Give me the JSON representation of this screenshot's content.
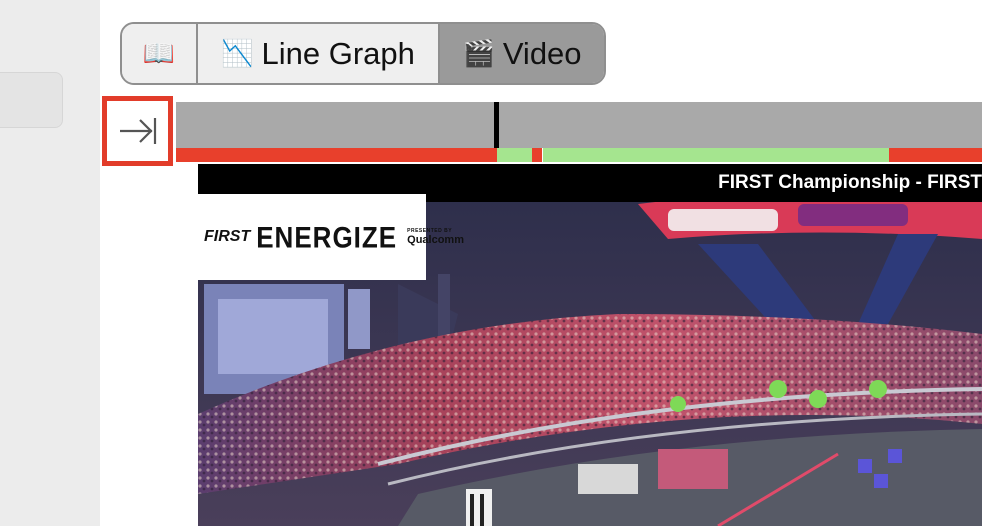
{
  "tabs": [
    {
      "id": "docs",
      "icon": "📖",
      "label": ""
    },
    {
      "id": "line-graph",
      "icon": "📉",
      "label": "Line Graph"
    },
    {
      "id": "video",
      "icon": "🎬",
      "label": "Video",
      "active": true
    }
  ],
  "timeline": {
    "cursor_position_fraction": 0.395,
    "status_segments": [
      {
        "start": 0.0,
        "end": 0.398,
        "status": "red",
        "color": "#e8402c"
      },
      {
        "start": 0.398,
        "end": 0.442,
        "status": "green",
        "color": "#a5e58f"
      },
      {
        "start": 0.442,
        "end": 0.455,
        "status": "red",
        "color": "#e8402c"
      },
      {
        "start": 0.455,
        "end": 0.884,
        "status": "green",
        "color": "#a5e58f"
      },
      {
        "start": 0.884,
        "end": 1.0,
        "status": "red",
        "color": "#e8402c"
      }
    ]
  },
  "video": {
    "stream_title": "FIRST Championship - FIRST",
    "overlay_logo": {
      "first": "FIRST",
      "season": "ENERGIZE",
      "presented_by": "PRESENTED BY",
      "sponsor": "Qualcomm"
    }
  },
  "colors": {
    "accent_outline": "#e23c2a",
    "active_tab": "#9a9a9a",
    "timeline_bg": "#a9a9a9"
  }
}
